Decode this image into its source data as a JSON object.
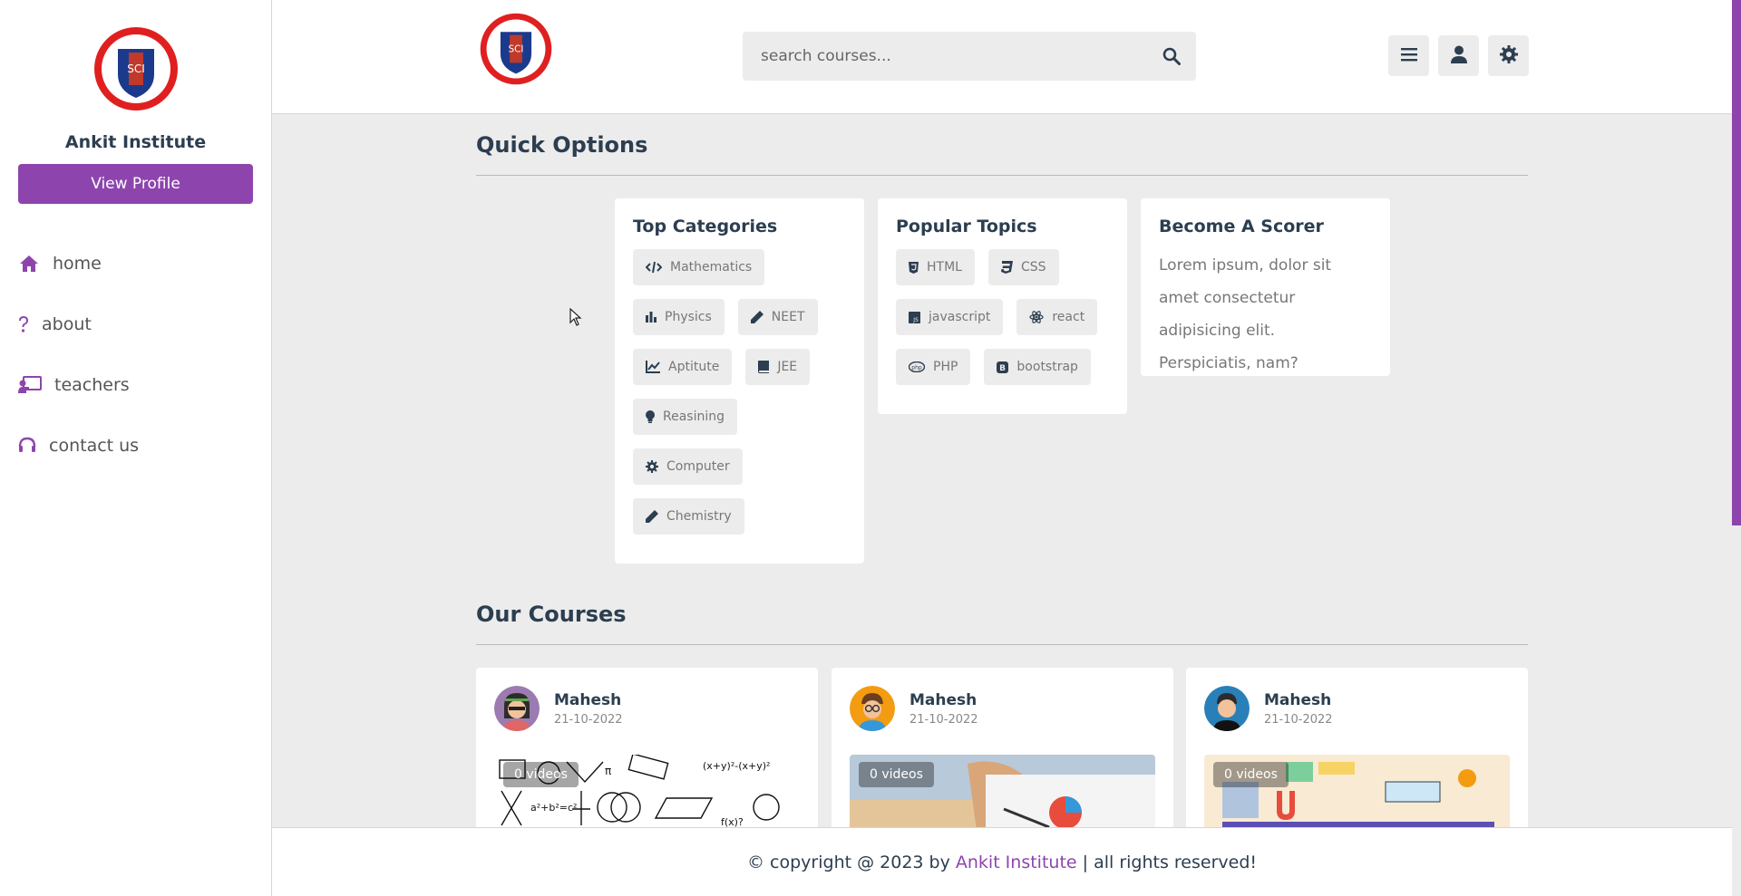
{
  "sidebar": {
    "name": "Ankit Institute",
    "view_profile_label": "View Profile",
    "items": [
      {
        "label": "home",
        "icon": "home-icon"
      },
      {
        "label": "about",
        "icon": "question-icon"
      },
      {
        "label": "teachers",
        "icon": "chalkboard-teacher-icon"
      },
      {
        "label": "contact us",
        "icon": "headset-icon"
      }
    ]
  },
  "header": {
    "search_placeholder": "search courses...",
    "buttons": [
      "menu-icon",
      "user-icon",
      "gear-icon"
    ]
  },
  "quick_options": {
    "title": "Quick Options",
    "top_categories": {
      "title": "Top Categories",
      "tags": [
        "Mathematics",
        "Physics",
        "NEET",
        "Aptitute",
        "JEE",
        "Reasining",
        "Computer",
        "Chemistry"
      ]
    },
    "popular_topics": {
      "title": "Popular Topics",
      "tags": [
        "HTML",
        "CSS",
        "javascript",
        "react",
        "PHP",
        "bootstrap"
      ]
    },
    "scorer": {
      "title": "Become A Scorer",
      "text": "Lorem ipsum, dolor sit amet consectetur adipisicing elit. Perspiciatis, nam?"
    }
  },
  "courses": {
    "title": "Our Courses",
    "items": [
      {
        "tutor": "Mahesh",
        "date": "21-10-2022",
        "videos": "0 videos"
      },
      {
        "tutor": "Mahesh",
        "date": "21-10-2022",
        "videos": "0 videos"
      },
      {
        "tutor": "Mahesh",
        "date": "21-10-2022",
        "videos": "0 videos"
      }
    ]
  },
  "footer": {
    "prefix": "© copyright @ 2023 by ",
    "brand": "Ankit Institute",
    "suffix": " | all rights reserved!"
  },
  "colors": {
    "accent": "#8e44ad",
    "background": "#ececec",
    "text": "#2c3e50"
  }
}
